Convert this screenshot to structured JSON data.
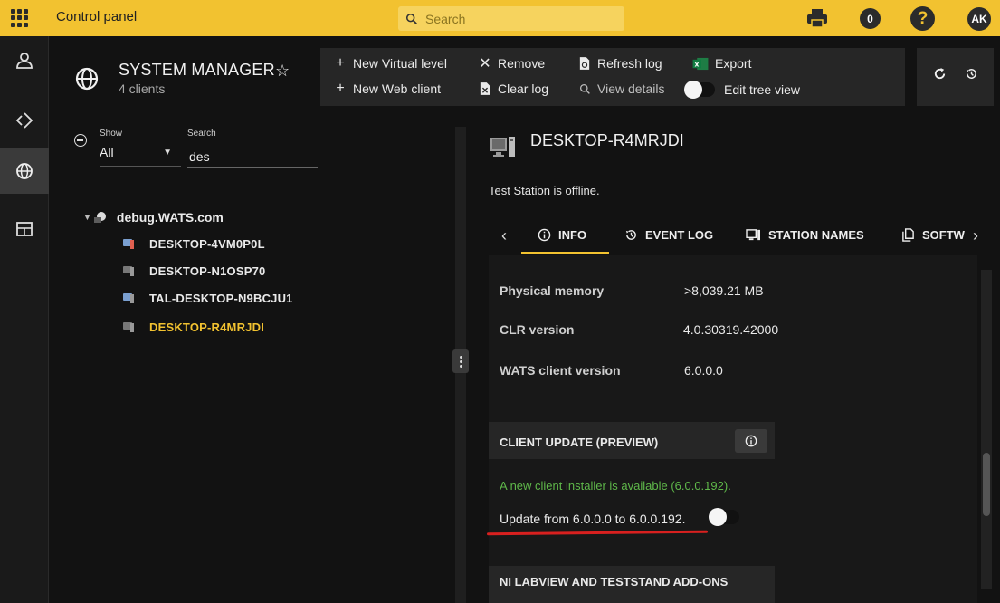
{
  "topbar": {
    "title": "Control panel",
    "search_placeholder": "Search",
    "notification_count": "0",
    "help_label": "?",
    "avatar_initials": "AK"
  },
  "manager": {
    "title": "SYSTEM MANAGER",
    "subtitle": "4 clients"
  },
  "toolbar": {
    "new_virtual_level": "New Virtual level",
    "new_web_client": "New Web client",
    "remove": "Remove",
    "clear_log": "Clear log",
    "refresh_log": "Refresh log",
    "view_details": "View details",
    "export": "Export",
    "edit_tree_view": "Edit tree view"
  },
  "filter": {
    "show_label": "Show",
    "show_value": "All",
    "search_label": "Search",
    "search_value": "des"
  },
  "tree": {
    "root": "debug.WATS.com",
    "items": [
      {
        "label": "DESKTOP-4VM0P0L",
        "status": "online-warning"
      },
      {
        "label": "DESKTOP-N1OSP70",
        "status": "offline"
      },
      {
        "label": "TAL-DESKTOP-N9BCJU1",
        "status": "online"
      },
      {
        "label": "DESKTOP-R4MRJDI",
        "status": "offline",
        "selected": true
      }
    ]
  },
  "station": {
    "name": "DESKTOP-R4MRJDI",
    "status_text": "Test Station is offline."
  },
  "tabs": [
    {
      "label": "INFO",
      "icon": "info-icon"
    },
    {
      "label": "EVENT LOG",
      "icon": "history-icon"
    },
    {
      "label": "STATION NAMES",
      "icon": "computer-icon"
    },
    {
      "label": "SOFTW",
      "icon": "copy-icon"
    }
  ],
  "info": [
    {
      "label": "Physical memory",
      "value": ">8,039.21 MB"
    },
    {
      "label": "CLR version",
      "value": "4.0.30319.42000"
    },
    {
      "label": "WATS client version",
      "value": "6.0.0.0"
    }
  ],
  "client_update": {
    "title": "CLIENT UPDATE (PREVIEW)",
    "available_text": "A new client installer is available (6.0.0.192).",
    "update_text": "Update from 6.0.0.0 to 6.0.0.192."
  },
  "ni_section": {
    "title": "NI LABVIEW AND TESTSTAND ADD-ONS"
  },
  "colors": {
    "accent": "#f2c230",
    "success": "#5fb84a",
    "highlight": "#d8201f"
  }
}
